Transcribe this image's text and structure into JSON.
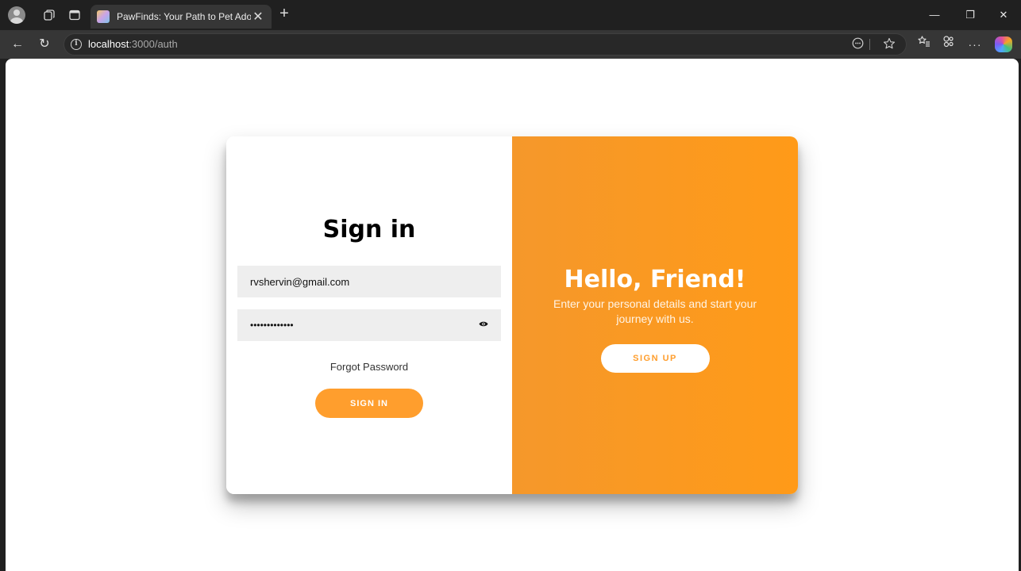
{
  "browser": {
    "tab_title": "PawFinds: Your Path to Pet Adopti",
    "tab_close": "✕",
    "new_tab": "+",
    "url_host": "localhost",
    "url_path": ":3000/auth",
    "window_controls": {
      "minimize": "—",
      "restore": "❐",
      "close": "✕"
    },
    "nav": {
      "back": "←",
      "refresh": "↻"
    },
    "more_label": "···"
  },
  "signin": {
    "title": "Sign in",
    "email_value": "rvshervin@gmail.com",
    "password_value": "•••••••••••••",
    "forgot_label": "Forgot Password",
    "button_label": "SIGN IN"
  },
  "overlay": {
    "heading": "Hello, Friend!",
    "subtext": "Enter your personal details and start your journey with us.",
    "button_label": "SIGN UP"
  },
  "colors": {
    "accent": "#ff9e2d",
    "overlay_gradient_start": "#f5982b",
    "overlay_gradient_end": "#ff9a18",
    "input_bg": "#eeeeee"
  }
}
